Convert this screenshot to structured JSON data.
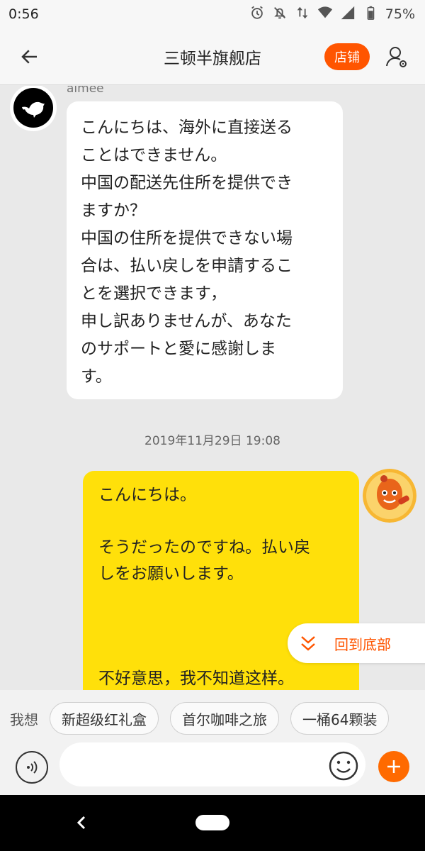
{
  "status_bar": {
    "time": "0:56",
    "battery_percent": "75%",
    "icons": [
      "alarm-icon",
      "notifications-off-icon",
      "data-arrows-icon",
      "wifi-icon",
      "signal-icon",
      "battery-icon"
    ]
  },
  "header": {
    "title": "三顿半旗舰店",
    "store_button": "店铺",
    "icons": [
      "back-arrow-icon",
      "user-settings-icon"
    ]
  },
  "chat": {
    "incoming": {
      "sender": "aimee",
      "avatar_icon": "bird-logo-icon",
      "text": "こんにちは、海外に直接送る\nことはできません。\n中国の配送先住所を提供でき\nますか？\n中国の住所を提供できない場\n合は、払い戻しを申請するこ\nとを選択できます，\n申し訳ありませんが、あなた\nのサポートと愛に感謝しま\nす。"
    },
    "timestamp": "2019年11月29日 19:08",
    "outgoing": {
      "avatar_icon": "cartoon-avatar-icon",
      "text": "こんにちは。\n\nそうだったのですね。払い戻\nしをお願いします。\n\n\n\n不好意思，我不知道这样。"
    },
    "scroll_to_bottom_label": "回到底部"
  },
  "suggestions": {
    "label": "我想",
    "chips": [
      "新超级红礼盒",
      "首尔咖啡之旅",
      "一桶64颗装"
    ]
  },
  "input": {
    "placeholder": "",
    "value": ""
  },
  "colors": {
    "accent": "#ff5500",
    "outgoing_bubble": "#ffe00a",
    "incoming_bubble": "#ffffff",
    "background": "#e9e9e9"
  }
}
